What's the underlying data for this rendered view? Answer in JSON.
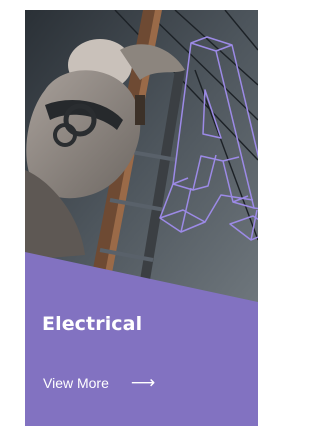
{
  "card": {
    "title": "Electrical",
    "link_label": "View More",
    "link_arrow": "⟶",
    "letter_icon": "letter-a-wireframe-icon",
    "colors": {
      "accent_panel": "#8272c1",
      "outline": "#9c8ae6",
      "text": "#ffffff"
    }
  }
}
